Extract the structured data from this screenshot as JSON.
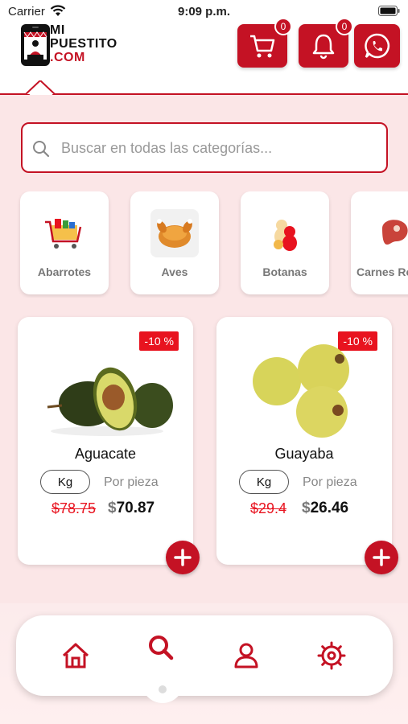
{
  "status_bar": {
    "carrier": "Carrier",
    "time": "9:09 p.m."
  },
  "header": {
    "logo_line1": "MI",
    "logo_line2": "PUESTITO",
    "logo_line3": ".COM",
    "cart_count": "0",
    "notifications_count": "0"
  },
  "search": {
    "placeholder": "Buscar en todas las categorías..."
  },
  "categories": [
    {
      "label": "Abarrotes",
      "icon": "grocery-cart-icon"
    },
    {
      "label": "Aves",
      "icon": "roast-chicken-icon"
    },
    {
      "label": "Botanas",
      "icon": "gummy-bears-icon"
    },
    {
      "label": "Carnes Rojas",
      "icon": "steak-icon"
    }
  ],
  "products": [
    {
      "name": "Aguacate",
      "discount": "-10 %",
      "unit": "Kg",
      "unit_alt": "Por pieza",
      "price_old": "$78.75",
      "currency": "$",
      "price_new": "70.87"
    },
    {
      "name": "Guayaba",
      "discount": "-10 %",
      "unit": "Kg",
      "unit_alt": "Por pieza",
      "price_old": "$29.4",
      "currency": "$",
      "price_new": "26.46"
    }
  ],
  "colors": {
    "brand": "#c41224",
    "discount": "#e8131f",
    "background": "#fbe6e7"
  },
  "bottom_nav": [
    "home-icon",
    "search-icon",
    "user-icon",
    "settings-icon"
  ]
}
